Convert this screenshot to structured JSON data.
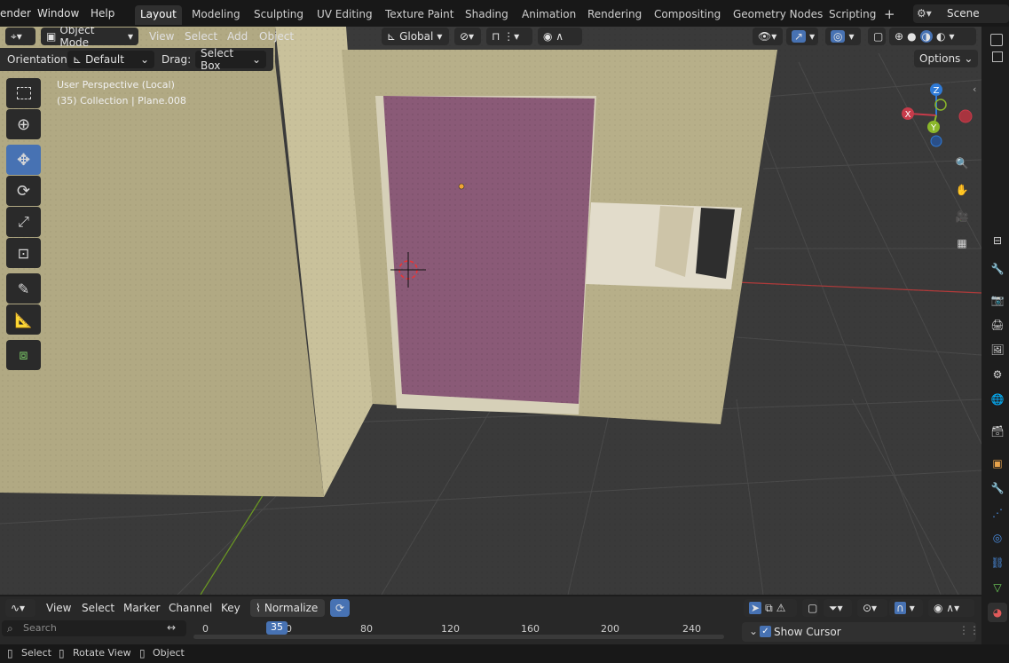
{
  "topbar": {
    "menus": [
      "ender",
      "Window",
      "Help"
    ],
    "workspaces": [
      "Layout",
      "Modeling",
      "Sculpting",
      "UV Editing",
      "Texture Paint",
      "Shading",
      "Animation",
      "Rendering",
      "Compositing",
      "Geometry Nodes",
      "Scripting"
    ],
    "add_tab": "+",
    "scene": "Scene"
  },
  "viewport_header": {
    "mode": "Object Mode",
    "menus": [
      "View",
      "Select",
      "Add",
      "Object"
    ],
    "transform_orientation": "Global"
  },
  "tool_settings": {
    "orientation_label": "Orientation:",
    "orientation_value": "Default",
    "drag_label": "Drag:",
    "drag_value": "Select Box",
    "options": "Options"
  },
  "overlay_text": {
    "perspective": "User Perspective (Local)",
    "collection": "(35) Collection | Plane.008"
  },
  "gizmo": {
    "z": "Z",
    "x": "X",
    "y": "Y",
    "colors": {
      "x": "#c73b4a",
      "y": "#8bb72a",
      "z": "#2f7ad6"
    }
  },
  "timeline": {
    "menus": [
      "View",
      "Select",
      "Marker",
      "Channel",
      "Key"
    ],
    "normalize": "Normalize",
    "search_placeholder": "Search",
    "current_frame": "35",
    "ticks": [
      "0",
      "0",
      "80",
      "120",
      "160",
      "200",
      "240"
    ],
    "show_cursor": "Show Cursor"
  },
  "statusbar": {
    "items": [
      "Select",
      "Rotate View",
      "Object"
    ]
  },
  "colors": {
    "accent": "#4772b3",
    "door": "#8a5a77",
    "wall": "#bdb58c"
  }
}
